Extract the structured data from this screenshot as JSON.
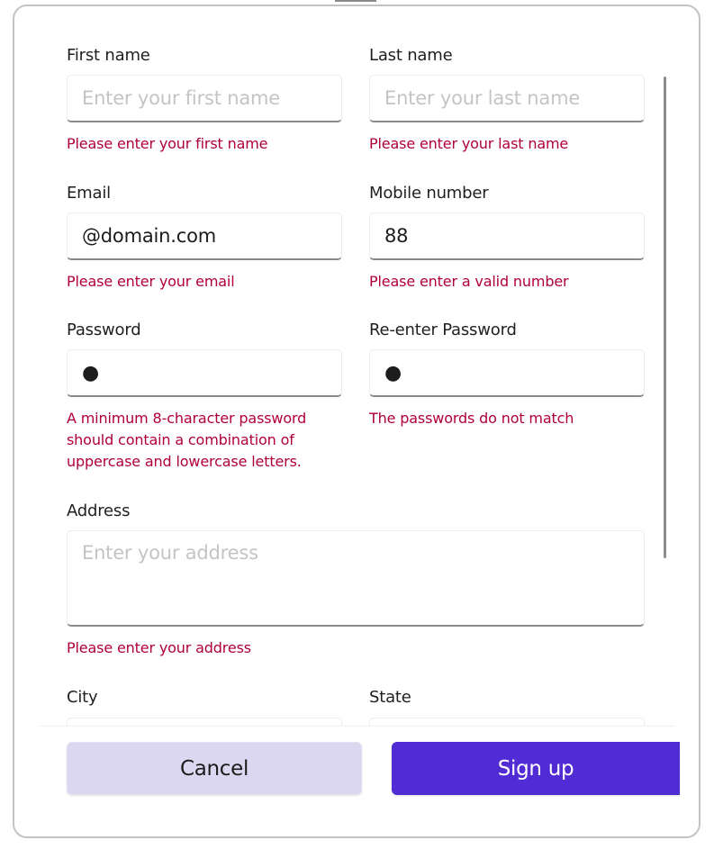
{
  "form": {
    "first_name": {
      "label": "First name",
      "placeholder": "Enter your first name",
      "value": "",
      "error": "Please enter your first name"
    },
    "last_name": {
      "label": "Last name",
      "placeholder": "Enter your last name",
      "value": "",
      "error": "Please enter your last name"
    },
    "email": {
      "label": "Email",
      "placeholder": "",
      "value": "@domain.com",
      "error": "Please enter your email"
    },
    "mobile": {
      "label": "Mobile number",
      "placeholder": "",
      "value": "88",
      "error": "Please enter a valid number"
    },
    "password": {
      "label": "Password",
      "masked_value": "●",
      "error": "A minimum 8-character password should contain a combination of uppercase and lowercase letters."
    },
    "reenter_password": {
      "label": "Re-enter Password",
      "masked_value": "●",
      "error": "The passwords do not match"
    },
    "address": {
      "label": "Address",
      "placeholder": "Enter your address",
      "value": "",
      "error": "Please enter your address"
    },
    "city": {
      "label": "City"
    },
    "state": {
      "label": "State"
    }
  },
  "footer": {
    "cancel_label": "Cancel",
    "signup_label": "Sign up"
  },
  "colors": {
    "accent": "#512bd4",
    "secondary_button": "#dcd7f0",
    "error": "#b0003a"
  }
}
